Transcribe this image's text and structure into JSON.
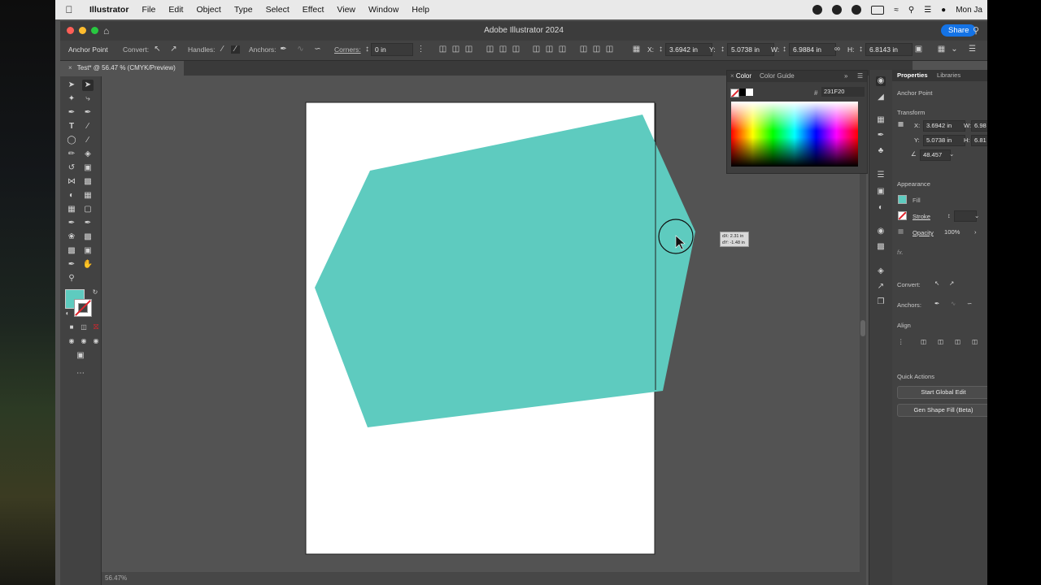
{
  "menubar": {
    "app": "Illustrator",
    "items": [
      "File",
      "Edit",
      "Object",
      "Type",
      "Select",
      "Effect",
      "View",
      "Window",
      "Help"
    ],
    "clock": "Mon Ja"
  },
  "window": {
    "title": "Adobe Illustrator 2024",
    "share_label": "Share"
  },
  "controlbar": {
    "mode": "Anchor Point",
    "convert_label": "Convert:",
    "handles_label": "Handles:",
    "anchors_label": "Anchors:",
    "corners_label": "Corners:",
    "corners_value": "0 in",
    "x_label": "X:",
    "x_value": "3.6942 in",
    "y_label": "Y:",
    "y_value": "5.0738 in",
    "w_label": "W:",
    "w_value": "6.9884 in",
    "h_label": "H:",
    "h_value": "6.8143 in"
  },
  "document": {
    "tab_label": "Test* @ 56.47 % (CMYK/Preview)"
  },
  "canvas": {
    "fill_color": "#5ecbbf",
    "drag_tooltip": {
      "dx": "dX: 2.31 in",
      "dy": "dY: -1.48 in"
    }
  },
  "color_panel": {
    "tab_color": "Color",
    "tab_guide": "Color Guide",
    "hash": "#",
    "hex_value": "231F20"
  },
  "properties": {
    "tab_properties": "Properties",
    "tab_libraries": "Libraries",
    "selection": "Anchor Point",
    "transform_title": "Transform",
    "x_label": "X:",
    "x_value": "3.6942 in",
    "w_label": "W:",
    "w_value": "6.98",
    "y_label": "Y:",
    "y_value": "5.0738 in",
    "h_label": "H:",
    "h_value": "6.81",
    "rotate_value": "48.457",
    "appearance_title": "Appearance",
    "fill_label": "Fill",
    "stroke_label": "Stroke",
    "opacity_label": "Opacity",
    "opacity_value": "100%",
    "fx": "fx.",
    "convert_label": "Convert:",
    "anchors_label": "Anchors:",
    "align_title": "Align",
    "quick_actions_title": "Quick Actions",
    "start_global_edit": "Start Global Edit",
    "gen_shape_fill": "Gen Shape Fill (Beta)"
  },
  "statusbar": {
    "zoom": "56.47%"
  }
}
